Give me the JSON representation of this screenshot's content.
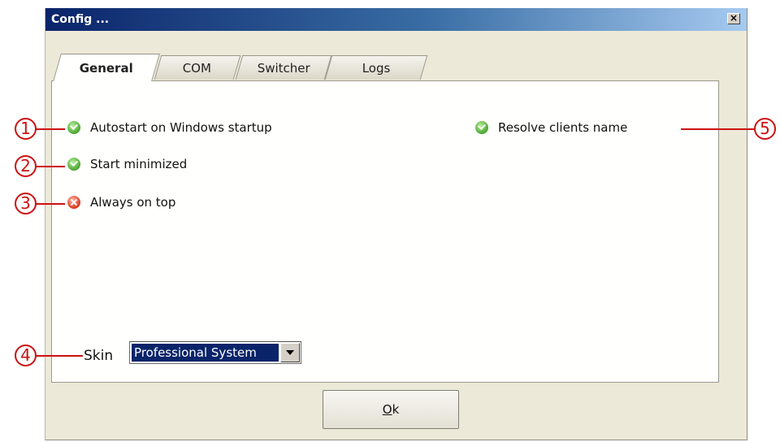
{
  "window": {
    "title": "Config ...",
    "close_label": "×"
  },
  "tabs": [
    {
      "label": "General",
      "active": true
    },
    {
      "label": "COM",
      "active": false
    },
    {
      "label": "Switcher",
      "active": false
    },
    {
      "label": "Logs",
      "active": false
    }
  ],
  "options": {
    "autostart": {
      "label": "Autostart on Windows startup",
      "checked": true,
      "icon": "green-check-icon"
    },
    "start_minimized": {
      "label": "Start minimized",
      "checked": true,
      "icon": "green-check-icon"
    },
    "always_on_top": {
      "label": "Always on top",
      "checked": false,
      "icon": "red-x-icon"
    },
    "resolve_clients": {
      "label": "Resolve clients name",
      "checked": true,
      "icon": "green-check-icon"
    }
  },
  "skin": {
    "label": "Skin",
    "value": "Professional System"
  },
  "ok_button": {
    "label": "Ok"
  },
  "callouts": [
    "1",
    "2",
    "3",
    "4",
    "5"
  ],
  "colors": {
    "callout": "#cc1111",
    "title_start": "#0a246a",
    "title_end": "#a6caf0",
    "check": "#4aa531",
    "cross": "#d9371c"
  }
}
